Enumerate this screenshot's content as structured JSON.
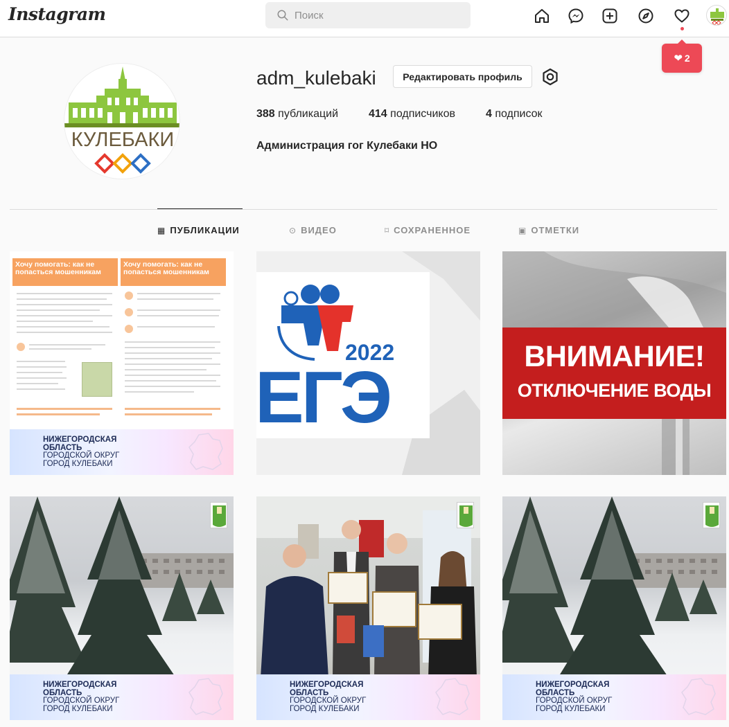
{
  "app": {
    "logo": "Instagram"
  },
  "search": {
    "placeholder": "Поиск"
  },
  "notifications": {
    "count": "2"
  },
  "profile": {
    "username": "adm_kulebaki",
    "edit_button": "Редактировать профиль",
    "posts_count": "388",
    "posts_label": " публикаций",
    "followers_count": "414",
    "followers_label": " подписчиков",
    "following_count": "4",
    "following_label": " подписок",
    "full_name": "Администрация гог Кулебаки НО",
    "avatar_text": "КУЛЕБАКИ"
  },
  "tabs": [
    {
      "label": "ПУБЛИКАЦИИ",
      "icon": "grid-icon",
      "active": true
    },
    {
      "label": "ВИДЕО",
      "icon": "video-icon",
      "active": false
    },
    {
      "label": "СОХРАНЕННОЕ",
      "icon": "bookmark-icon",
      "active": false
    },
    {
      "label": "ОТМЕТКИ",
      "icon": "tag-icon",
      "active": false
    }
  ],
  "posts": [
    {
      "type": "leaflet",
      "title_left": "Хочу помогать: как не попасться мошенникам",
      "title_right": "Хочу помогать: как не попасться мошенникам",
      "banner": [
        "НИЖЕГОРОДСКАЯ",
        "ОБЛАСТЬ",
        "ГОРОДСКОЙ ОКРУГ",
        "ГОРОД КУЛЕБАКИ"
      ]
    },
    {
      "type": "ege",
      "year": "2022",
      "text": "ЕГЭ"
    },
    {
      "type": "water",
      "line1": "ВНИМАНИЕ!",
      "line2": "ОТКЛЮЧЕНИЕ ВОДЫ"
    },
    {
      "type": "winter",
      "banner": [
        "НИЖЕГОРОДСКАЯ",
        "ОБЛАСТЬ",
        "ГОРОДСКОЙ ОКРУГ",
        "ГОРОД КУЛЕБАКИ"
      ]
    },
    {
      "type": "award",
      "banner": [
        "НИЖЕГОРОДСКАЯ",
        "ОБЛАСТЬ",
        "ГОРОДСКОЙ ОКРУГ",
        "ГОРОД КУЛЕБАКИ"
      ]
    },
    {
      "type": "winter",
      "banner": [
        "НИЖЕГОРОДСКАЯ",
        "ОБЛАСТЬ",
        "ГОРОДСКОЙ ОКРУГ",
        "ГОРОД КУЛЕБАКИ"
      ]
    }
  ],
  "colors": {
    "accent_red": "#ed4956",
    "ege_blue": "#1f62b8",
    "water_red": "#c41e1e",
    "leaflet_orange": "#f7a260"
  }
}
